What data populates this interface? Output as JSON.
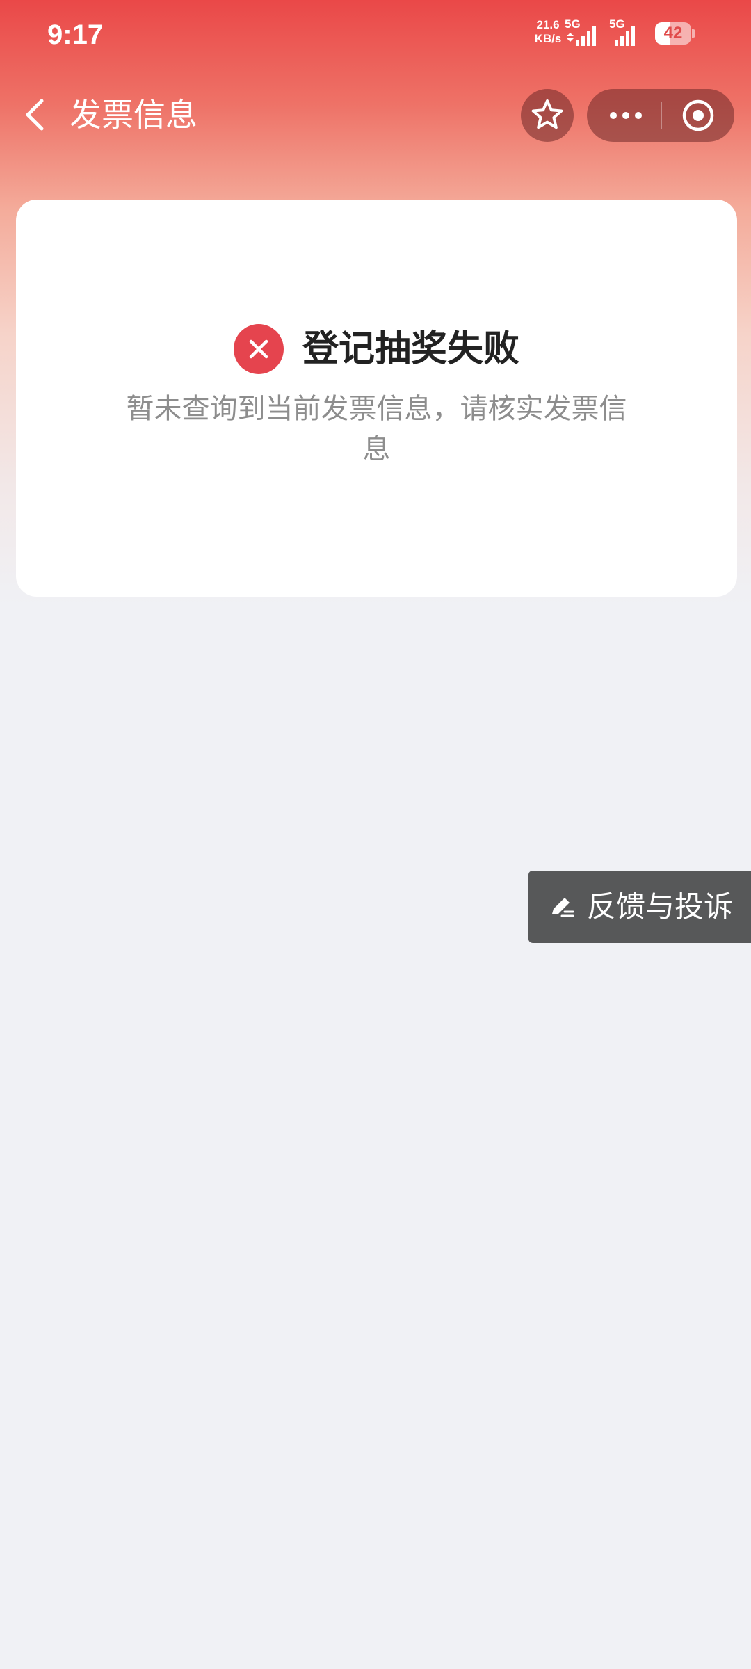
{
  "status_bar": {
    "time": "9:17",
    "net_speed_value": "21.6",
    "net_speed_unit": "KB/s",
    "sim1_label": "5G",
    "sim2_label": "5G",
    "battery_level": "42",
    "battery_fraction": 0.42
  },
  "nav": {
    "title": "发票信息",
    "back_icon": "chevron-left-icon",
    "favorite_icon": "star-icon",
    "more_icon": "more-dots-icon",
    "close_icon": "target-circle-icon"
  },
  "result": {
    "status_icon": "error-x-icon",
    "title": "登记抽奖失败",
    "message": "暂未查询到当前发票信息，请核实发票信息"
  },
  "feedback": {
    "icon": "edit-pen-icon",
    "label": "反馈与投诉"
  },
  "colors": {
    "header_top": "#ea4848",
    "page_background": "#f0f1f5",
    "error_red": "#e5444e",
    "feedback_bg": "#575859",
    "secondary_text": "#8d8d8d"
  }
}
